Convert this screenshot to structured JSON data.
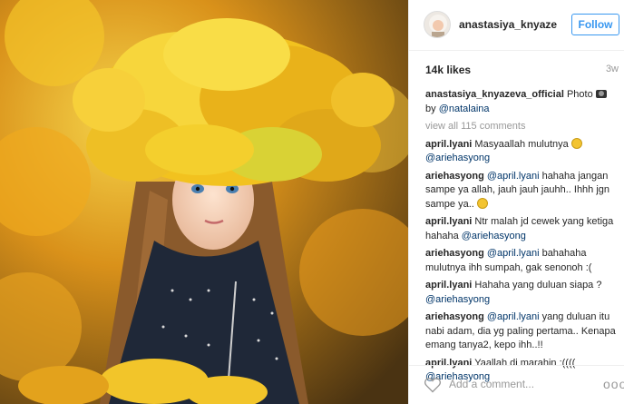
{
  "post": {
    "username": "anastasiya_knyazeva_official",
    "username_short": "anastasiya_knyazev...",
    "follow_label": "Follow",
    "likes": "14k likes",
    "age": "3w"
  },
  "caption": {
    "user": "anastasiya_knyazeva_official",
    "text": "Photo",
    "by_prefix": "by",
    "by_mention": "@natalaina"
  },
  "view_all": "view all 115 comments",
  "comments": [
    {
      "user": "april.lyani",
      "parts": [
        {
          "t": "Masyaallah mulutnya "
        },
        {
          "e": "emoji"
        },
        {
          "t": " "
        },
        {
          "m": "@ariehasyong"
        }
      ]
    },
    {
      "user": "ariehasyong",
      "parts": [
        {
          "m": "@april.lyani"
        },
        {
          "t": " hahaha jangan sampe ya allah, jauh jauh jauhh.. Ihhh jgn sampe ya.. "
        },
        {
          "e": "emoji"
        }
      ]
    },
    {
      "user": "april.lyani",
      "parts": [
        {
          "t": "Ntr malah jd cewek yang ketiga hahaha "
        },
        {
          "m": "@ariehasyong"
        }
      ]
    },
    {
      "user": "ariehasyong",
      "parts": [
        {
          "m": "@april.lyani"
        },
        {
          "t": " bahahaha mulutnya ihh sumpah, gak senonoh :("
        }
      ]
    },
    {
      "user": "april.lyani",
      "parts": [
        {
          "t": "Hahaha yang duluan siapa ? "
        },
        {
          "m": "@ariehasyong"
        }
      ]
    },
    {
      "user": "ariehasyong",
      "parts": [
        {
          "m": "@april.lyani"
        },
        {
          "t": " yang duluan itu nabi adam, dia yg paling pertama.. Kenapa emang tanya2, kepo ihh..!!"
        }
      ]
    },
    {
      "user": "april.lyani",
      "parts": [
        {
          "t": "Yaallah di marahin :(((( "
        },
        {
          "m": "@ariehasyong"
        }
      ]
    }
  ],
  "footer": {
    "add_comment_placeholder": "Add a comment...",
    "more_label": "ooo"
  },
  "colors": {
    "accent": "#3897f0",
    "mention": "#003569",
    "muted": "#999999"
  },
  "icons": {
    "heart": "heart-outline-icon",
    "camera": "camera-icon"
  }
}
